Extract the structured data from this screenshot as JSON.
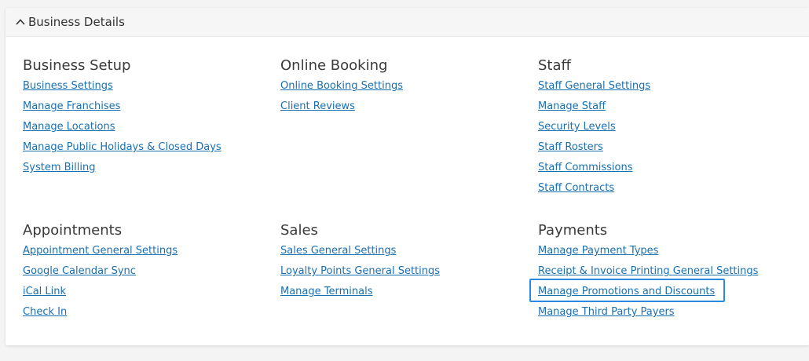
{
  "panel": {
    "title": "Business Details"
  },
  "sections": [
    {
      "title": "Business Setup",
      "links": [
        "Business Settings",
        "Manage Franchises",
        "Manage Locations",
        "Manage Public Holidays & Closed Days",
        "System Billing"
      ]
    },
    {
      "title": "Online Booking",
      "links": [
        "Online Booking Settings",
        "Client Reviews"
      ]
    },
    {
      "title": "Staff",
      "links": [
        "Staff General Settings",
        "Manage Staff",
        "Security Levels",
        "Staff Rosters",
        "Staff Commissions",
        "Staff Contracts"
      ]
    },
    {
      "title": "Appointments",
      "links": [
        "Appointment General Settings",
        "Google Calendar Sync",
        "iCal Link",
        "Check In"
      ]
    },
    {
      "title": "Sales",
      "links": [
        "Sales General Settings",
        "Loyalty Points General Settings",
        "Manage Terminals"
      ]
    },
    {
      "title": "Payments",
      "links": [
        "Manage Payment Types",
        "Receipt & Invoice Printing General Settings",
        "Manage Promotions and Discounts",
        "Manage Third Party Payers"
      ]
    }
  ],
  "highlighted_link": "Manage Promotions and Discounts",
  "colors": {
    "link": "#1a6fb0",
    "highlight": "#2a8ae2"
  }
}
